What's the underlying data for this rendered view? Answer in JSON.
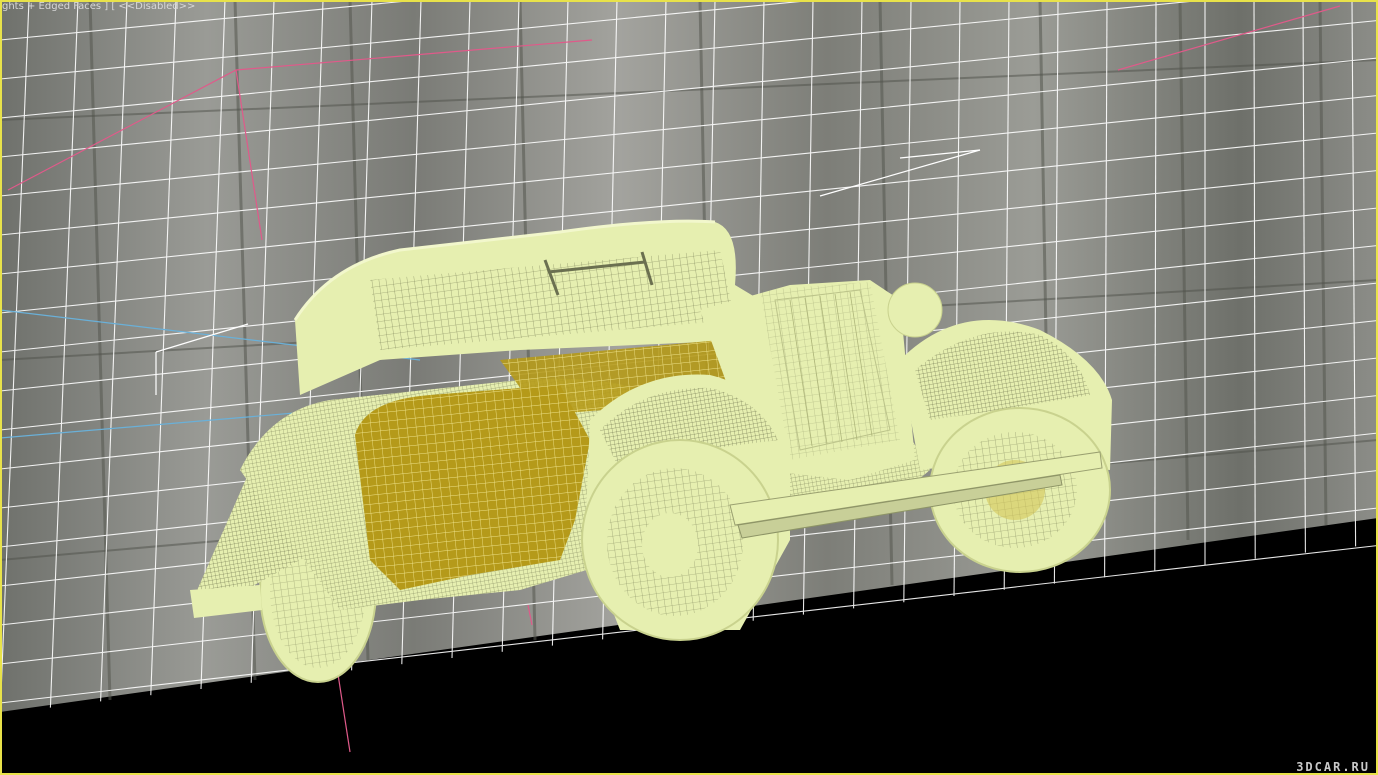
{
  "viewport": {
    "label": {
      "shading_mode": "ghts + Edged Faces",
      "separator": " ] [ ",
      "lighting_state": "<<Disabled>>"
    },
    "watermark": "3DCAR.RU"
  },
  "colors": {
    "border_active": "#e8e24a",
    "wireframe_body": "#e6efb0",
    "wireframe_mesh": "#ffffff",
    "interior_panel": "#b59a1a",
    "grid": "#ffffff",
    "background": "#000000",
    "wall_texture": "#8a8a86",
    "light_helper_pink": "#e05a8a",
    "light_helper_blue": "#6ab0d8"
  },
  "icons": [
    "viewport-camera",
    "car-wireframe-model"
  ]
}
